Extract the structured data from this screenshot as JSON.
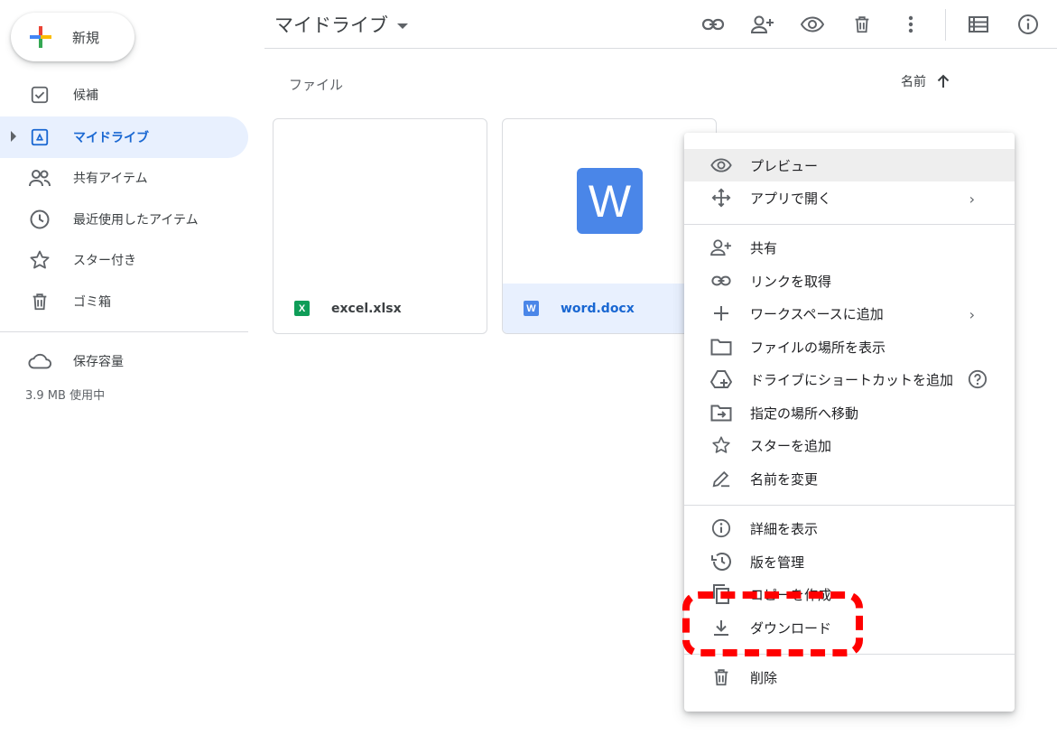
{
  "new_button": {
    "label": "新規"
  },
  "sidebar": {
    "items": [
      {
        "label": "候補",
        "icon": "check-box-icon"
      },
      {
        "label": "マイドライブ",
        "icon": "drive-icon",
        "active": true
      },
      {
        "label": "共有アイテム",
        "icon": "people-icon"
      },
      {
        "label": "最近使用したアイテム",
        "icon": "clock-icon"
      },
      {
        "label": "スター付き",
        "icon": "star-icon"
      },
      {
        "label": "ゴミ箱",
        "icon": "trash-icon"
      }
    ],
    "storage": {
      "label": "保存容量",
      "usage": "3.9 MB 使用中"
    }
  },
  "header": {
    "title": "マイドライブ"
  },
  "content": {
    "section_label": "ファイル",
    "sort_label": "名前",
    "files": [
      {
        "name": "excel.xlsx",
        "badge": "X",
        "color": "#0f9d58"
      },
      {
        "name": "word.docx",
        "badge": "W",
        "color": "#4a86e8",
        "selected": true
      }
    ]
  },
  "context_menu": {
    "items": [
      {
        "label": "プレビュー",
        "icon": "eye-icon"
      },
      {
        "label": "アプリで開く",
        "icon": "move-arrows-icon",
        "submenu": true
      },
      {
        "label": "共有",
        "icon": "person-add-icon"
      },
      {
        "label": "リンクを取得",
        "icon": "link-icon"
      },
      {
        "label": "ワークスペースに追加",
        "icon": "plus-icon",
        "submenu": true
      },
      {
        "label": "ファイルの場所を表示",
        "icon": "folder-icon"
      },
      {
        "label": "ドライブにショートカットを追加",
        "icon": "drive-shortcut-icon"
      },
      {
        "label": "指定の場所へ移動",
        "icon": "move-to-folder-icon"
      },
      {
        "label": "スターを追加",
        "icon": "star-icon"
      },
      {
        "label": "名前を変更",
        "icon": "pencil-icon"
      },
      {
        "label": "詳細を表示",
        "icon": "info-icon"
      },
      {
        "label": "版を管理",
        "icon": "history-icon"
      },
      {
        "label": "コピーを作成",
        "icon": "copy-icon"
      },
      {
        "label": "ダウンロード",
        "icon": "download-icon"
      },
      {
        "label": "削除",
        "icon": "trash-icon"
      }
    ]
  },
  "colors": {
    "accent": "#1967d2",
    "active_bg": "#e8f0fe",
    "callout": "#ff0000"
  }
}
